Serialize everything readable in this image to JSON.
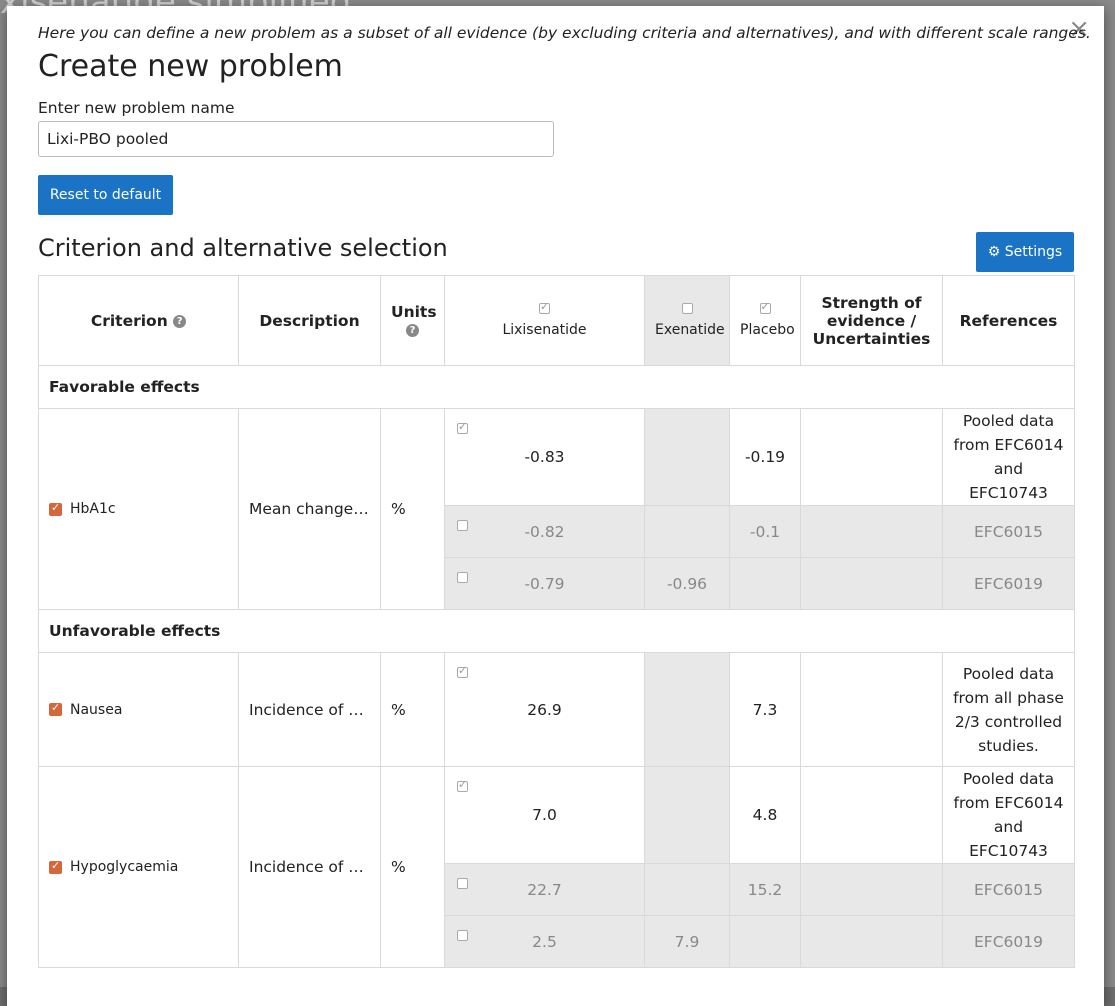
{
  "modal": {
    "intro": "Here you can define a new problem as a subset of all evidence (by excluding criteria and alternatives), and with different scale ranges.",
    "title": "Create new problem",
    "name_label": "Enter new problem name",
    "name_value": "Lixi-PBO pooled",
    "reset_label": "Reset to default",
    "section_title": "Criterion and alternative selection",
    "settings_label": "Settings",
    "close_label": "×"
  },
  "background": {
    "title": "xisenatide simplified"
  },
  "table": {
    "headers": {
      "criterion": "Criterion",
      "description": "Description",
      "units": "Units",
      "strength": "Strength of evidence / Uncertainties",
      "references": "References"
    },
    "alternatives": [
      "Lixisenatide",
      "Exenatide",
      "Placebo"
    ],
    "sections": {
      "favorable": "Favorable effects",
      "unfavorable": "Unfavorable effects"
    },
    "rows": {
      "hba1c": {
        "name": "HbA1c",
        "desc": "Mean change i...",
        "unit": "%",
        "r1": {
          "lixi": "-0.83",
          "exe": "",
          "pbo": "-0.19",
          "ref": "Pooled data from EFC6014 and EFC10743"
        },
        "r2": {
          "lixi": "-0.82",
          "exe": "",
          "pbo": "-0.1",
          "ref": "EFC6015"
        },
        "r3": {
          "lixi": "-0.79",
          "exe": "-0.96",
          "pbo": "",
          "ref": "EFC6019"
        }
      },
      "nausea": {
        "name": "Nausea",
        "desc": "Incidence of na...",
        "unit": "%",
        "r1": {
          "lixi": "26.9",
          "exe": "",
          "pbo": "7.3",
          "ref": "Pooled data from all phase 2/3 controlled studies."
        }
      },
      "hypo": {
        "name": "Hypoglycaemia",
        "desc": "Incidence of hy...",
        "unit": "%",
        "r1": {
          "lixi": "7.0",
          "exe": "",
          "pbo": "4.8",
          "ref": "Pooled data from EFC6014 and EFC10743"
        },
        "r2": {
          "lixi": "22.7",
          "exe": "",
          "pbo": "15.2",
          "ref": "EFC6015"
        },
        "r3": {
          "lixi": "2.5",
          "exe": "7.9",
          "pbo": "",
          "ref": "EFC6019"
        }
      }
    }
  }
}
